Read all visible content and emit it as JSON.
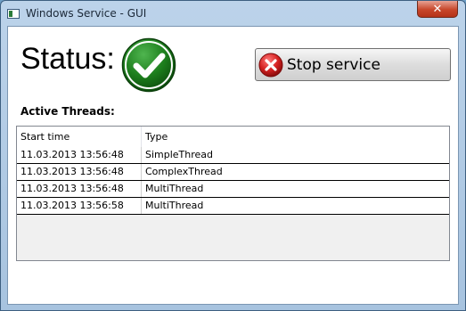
{
  "window": {
    "title": "Windows Service - GUI",
    "close_glyph": "✕"
  },
  "status": {
    "label": "Status:",
    "icon": "green-checkmark-icon"
  },
  "stop_button": {
    "label": "Stop service",
    "icon": "red-x-icon"
  },
  "threads": {
    "heading": "Active Threads:",
    "columns": [
      "Start time",
      "Type"
    ],
    "rows": [
      [
        "11.03.2013 13:56:48",
        "SimpleThread"
      ],
      [
        "11.03.2013 13:56:48",
        "ComplexThread"
      ],
      [
        "11.03.2013 13:56:48",
        "MultiThread"
      ],
      [
        "11.03.2013 13:56:58",
        "MultiThread"
      ]
    ]
  },
  "colors": {
    "status_ok": "#1f7a1f",
    "stop_red": "#d42020",
    "close_red": "#c7462a"
  }
}
